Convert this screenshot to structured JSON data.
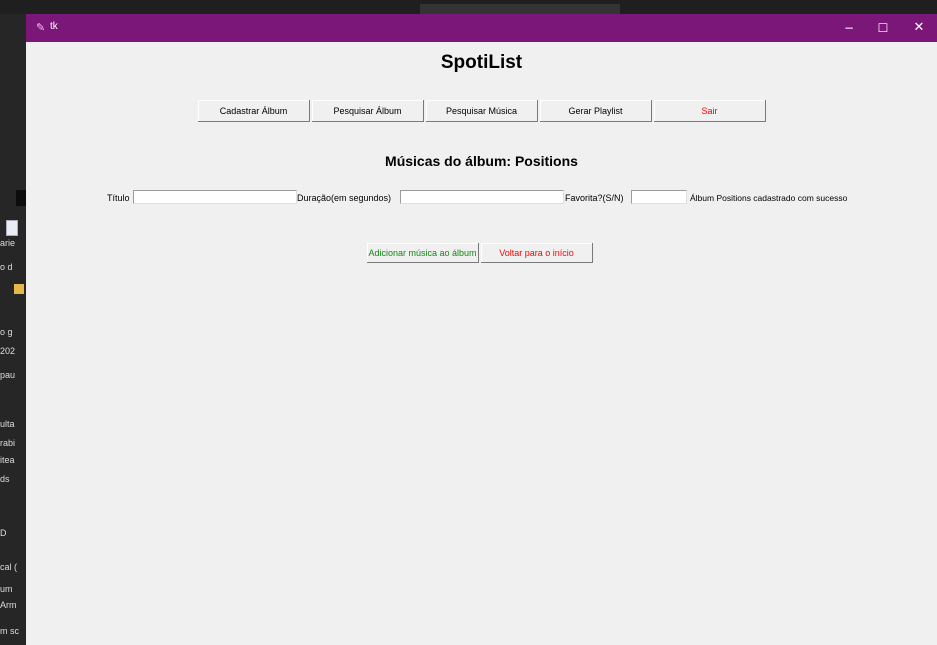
{
  "desktop": {
    "fragments": [
      "arie",
      "o d",
      "o g",
      "202",
      "pau",
      "ulta",
      "rabi",
      "itea",
      "ds",
      "D",
      "cal (",
      "um",
      "Arm",
      "m sc"
    ]
  },
  "window": {
    "title": "tk",
    "app_icon": "feather-icon",
    "controls": {
      "minimize": "−",
      "maximize": "☐",
      "close": "✕"
    }
  },
  "app": {
    "title": "SpotiList",
    "menu": [
      "Cadastrar Álbum",
      "Pesquisar Álbum",
      "Pesquisar Música",
      "Gerar Playlist",
      "Sair"
    ],
    "subtitle": "Músicas do álbum: Positions",
    "form": {
      "titulo_label": "Título",
      "titulo_value": "",
      "duracao_label": "Duração(em segundos)",
      "duracao_value": "",
      "favorita_label": "Favorita?(S/N)",
      "favorita_value": ""
    },
    "status": "Álbum Positions cadastrado com sucesso",
    "actions": {
      "add": "Adicionar música ao álbum",
      "back": "Voltar para o início"
    }
  },
  "colors": {
    "titlebar": "#7a1778",
    "window_bg": "#f0f0f0",
    "exit_text": "#ff0000",
    "add_text": "#118811"
  }
}
